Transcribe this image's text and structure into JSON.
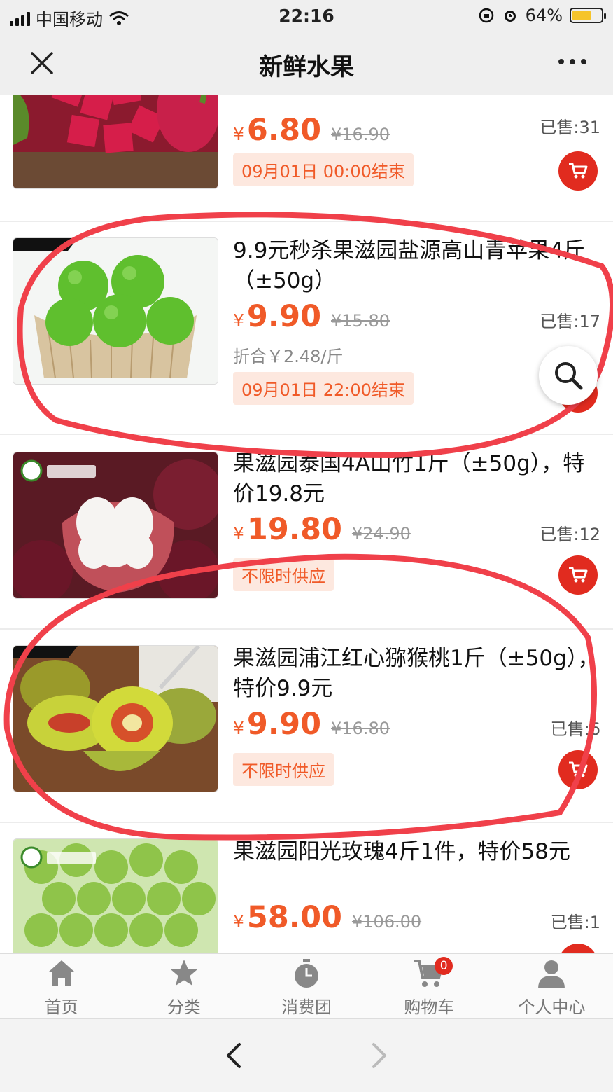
{
  "status": {
    "carrier": "中国移动",
    "time": "22:16",
    "battery": "64%",
    "battery_level": 0.64
  },
  "header": {
    "title": "新鲜水果"
  },
  "products": [
    {
      "name": "",
      "price": "6.80",
      "original": "¥16.90",
      "unit_price": "",
      "badge": "09月01日 00:00结束",
      "sold": "已售:31"
    },
    {
      "name": "9.9元秒杀果滋园盐源高山青苹果4斤（±50g）",
      "price": "9.90",
      "original": "¥15.80",
      "unit_price": "折合￥2.48/斤",
      "badge": "09月01日 22:00结束",
      "sold": "已售:17"
    },
    {
      "name": "果滋园泰国4A山竹1斤（±50g），特价19.8元",
      "price": "19.80",
      "original": "¥24.90",
      "unit_price": "",
      "badge": "不限时供应",
      "sold": "已售:12"
    },
    {
      "name": "果滋园浦江红心猕猴桃1斤（±50g），特价9.9元",
      "price": "9.90",
      "original": "¥16.80",
      "unit_price": "",
      "badge": "不限时供应",
      "sold": "已售:6"
    },
    {
      "name": "果滋园阳光玫瑰4斤1件，特价58元",
      "price": "58.00",
      "original": "¥106.00",
      "unit_price": "",
      "badge": "",
      "sold": "已售:1"
    }
  ],
  "currency": "¥",
  "tabs": [
    {
      "label": "首页",
      "icon": "home-icon"
    },
    {
      "label": "分类",
      "icon": "star-icon"
    },
    {
      "label": "消费团",
      "icon": "timer-icon"
    },
    {
      "label": "购物车",
      "icon": "cart-icon",
      "count": "0"
    },
    {
      "label": "个人中心",
      "icon": "user-icon"
    }
  ],
  "colors": {
    "accent": "#f05a28",
    "cart_button": "#e12b1f",
    "annotation": "#f0404a"
  }
}
